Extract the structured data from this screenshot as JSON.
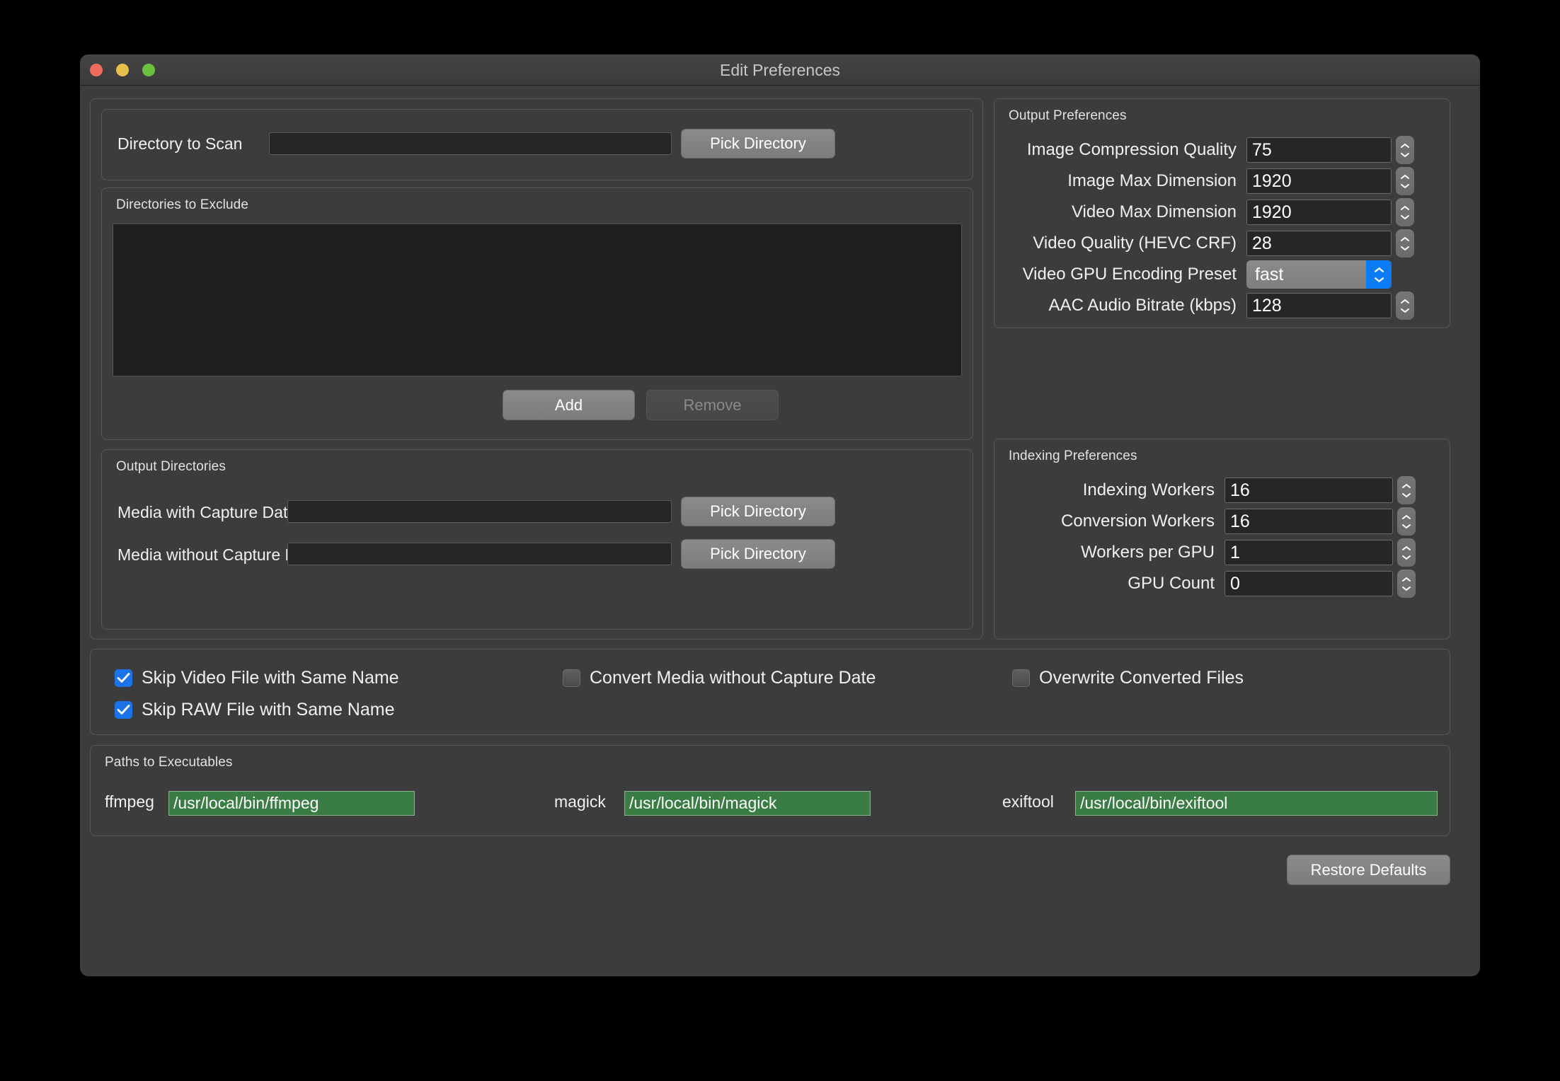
{
  "window": {
    "title": "Edit Preferences",
    "traffic_lights": [
      "close-button",
      "minimize-button",
      "zoom-button"
    ]
  },
  "directory_to_scan": {
    "label": "Directory to Scan",
    "value": "",
    "placeholder": "",
    "pick_button": "Pick Directory"
  },
  "directories_to_exclude": {
    "legend": "Directories to Exclude",
    "items": [],
    "add_button": "Add",
    "remove_button": "Remove",
    "remove_disabled": true
  },
  "output_directories": {
    "legend": "Output Directories",
    "rows": [
      {
        "label": "Media with Capture Date",
        "value": "",
        "pick_button": "Pick Directory"
      },
      {
        "label": "Media without Capture Date",
        "value": "",
        "pick_button": "Pick Directory"
      }
    ]
  },
  "output_preferences": {
    "legend": "Output Preferences",
    "rows": [
      {
        "label": "Image Compression Quality",
        "value": "75",
        "kind": "spin"
      },
      {
        "label": "Image Max Dimension",
        "value": "1920",
        "kind": "spin"
      },
      {
        "label": "Video Max Dimension",
        "value": "1920",
        "kind": "spin"
      },
      {
        "label": "Video Quality (HEVC CRF)",
        "value": "28",
        "kind": "spin"
      },
      {
        "label": "Video GPU Encoding Preset",
        "value": "fast",
        "kind": "popup"
      },
      {
        "label": "AAC Audio Bitrate (kbps)",
        "value": "128",
        "kind": "spin"
      }
    ]
  },
  "indexing_preferences": {
    "legend": "Indexing Preferences",
    "rows": [
      {
        "label": "Indexing Workers",
        "value": "16"
      },
      {
        "label": "Conversion Workers",
        "value": "16"
      },
      {
        "label": "Workers per GPU",
        "value": "1"
      },
      {
        "label": "GPU Count",
        "value": "0"
      }
    ]
  },
  "checkboxes": [
    {
      "label": "Skip Video File with Same Name",
      "checked": true
    },
    {
      "label": "Skip RAW File with Same Name",
      "checked": true
    },
    {
      "label": "Convert Media without Capture Date",
      "checked": false
    },
    {
      "label": "Overwrite Converted Files",
      "checked": false
    }
  ],
  "paths_to_executables": {
    "legend": "Paths to Executables",
    "entries": [
      {
        "label": "ffmpeg",
        "value": "/usr/local/bin/ffmpeg"
      },
      {
        "label": "magick",
        "value": "/usr/local/bin/magick"
      },
      {
        "label": "exiftool",
        "value": "/usr/local/bin/exiftool"
      }
    ]
  },
  "footer": {
    "restore_defaults": "Restore Defaults"
  },
  "colors": {
    "accent_blue": "#0a7cf5",
    "checkbox_blue": "#1a73e8",
    "path_green": "#3a7d44",
    "window_bg": "#3c3c3c",
    "field_bg": "#262626"
  }
}
